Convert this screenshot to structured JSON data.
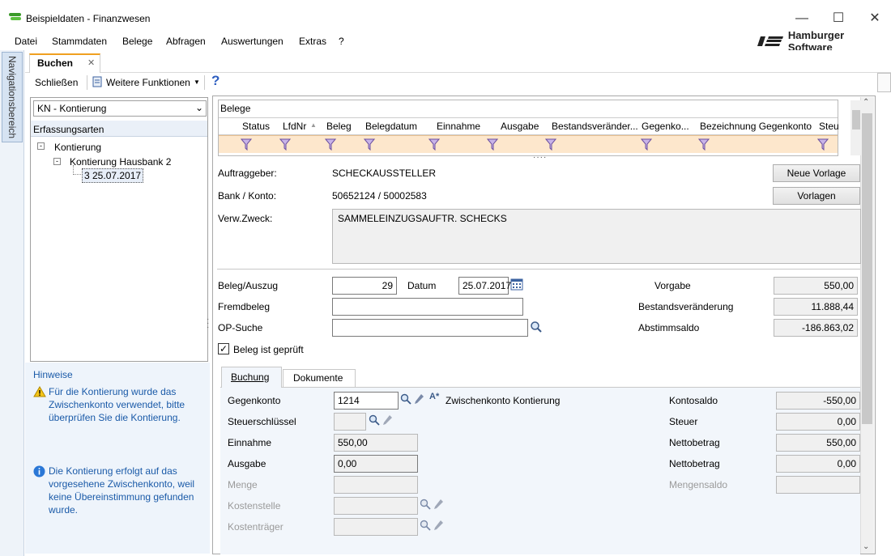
{
  "window": {
    "title": "Beispieldaten - Finanzwesen"
  },
  "menu": {
    "items": [
      "Datei",
      "Stammdaten",
      "Belege",
      "Abfragen",
      "Auswertungen",
      "Extras",
      "?"
    ]
  },
  "brand": {
    "text": "Hamburger Software"
  },
  "nav": {
    "label": "Navigationsbereich"
  },
  "doc_tab": {
    "label": "Buchen",
    "close": "✕"
  },
  "toolbar": {
    "close_label": "Schließen",
    "more_label": "Weitere Funktionen",
    "help": "?"
  },
  "left": {
    "select_value": "KN - Kontierung",
    "section": "Erfassungsarten",
    "tree": {
      "root": "Kontierung",
      "child": "Kontierung Hausbank 2",
      "leaf": "3 25.07.2017"
    }
  },
  "hints": {
    "title": "Hinweise",
    "warning": "Für die Kontierung wurde das Zwischenkonto verwendet, bitte überprüfen Sie die Kontierung.",
    "info": "Die Kontierung erfolgt auf das vorgesehene Zwischenkonto, weil keine Übereinstimmung gefunden wurde."
  },
  "grid": {
    "title": "Belege",
    "columns": [
      "Status",
      "LfdNr",
      "Beleg",
      "Belegdatum",
      "Einnahme",
      "Ausgabe",
      "Bestandsveränder...",
      "Gegenko...",
      "Bezeichnung Gegenkonto",
      "Steu"
    ]
  },
  "info": {
    "auftraggeber_label": "Auftraggeber:",
    "auftraggeber_value": "SCHECKAUSSTELLER",
    "bank_label": "Bank / Konto:",
    "bank_value": "50652124 / 50002583",
    "zweck_label": "Verw.Zweck:",
    "zweck_value": "SAMMELEINZUGSAUFTR. SCHECKS",
    "btn_neue": "Neue Vorlage",
    "btn_vorlagen": "Vorlagen"
  },
  "beleg": {
    "auszug_label": "Beleg/Auszug",
    "auszug_value": "29",
    "datum_label": "Datum",
    "datum_value": "25.07.2017",
    "fremd_label": "Fremdbeleg",
    "fremd_value": "",
    "op_label": "OP-Suche",
    "op_value": "",
    "checked_label": "Beleg ist geprüft",
    "vorgabe_label": "Vorgabe",
    "vorgabe_value": "550,00",
    "bestand_label": "Bestandsveränderung",
    "bestand_value": "11.888,44",
    "abstimm_label": "Abstimmsaldo",
    "abstimm_value": "-186.863,02"
  },
  "subtabs": {
    "buchung": "Buchung",
    "dokumente": "Dokumente"
  },
  "buchung": {
    "gegenkonto_label": "Gegenkonto",
    "gegenkonto_value": "1214",
    "gegenkonto_desc": "Zwischenkonto Kontierung",
    "steuer_label": "Steuerschlüssel",
    "einnahme_label": "Einnahme",
    "einnahme_value": "550,00",
    "ausgabe_label": "Ausgabe",
    "ausgabe_value": "0,00",
    "menge_label": "Menge",
    "kostenstelle_label": "Kostenstelle",
    "kostentraeger_label": "Kostenträger",
    "kontosaldo_label": "Kontosaldo",
    "kontosaldo_value": "-550,00",
    "steuer2_label": "Steuer",
    "steuer2_value": "0,00",
    "netto1_label": "Nettobetrag",
    "netto1_value": "550,00",
    "netto2_label": "Nettobetrag",
    "netto2_value": "0,00",
    "mengensaldo_label": "Mengensaldo"
  }
}
